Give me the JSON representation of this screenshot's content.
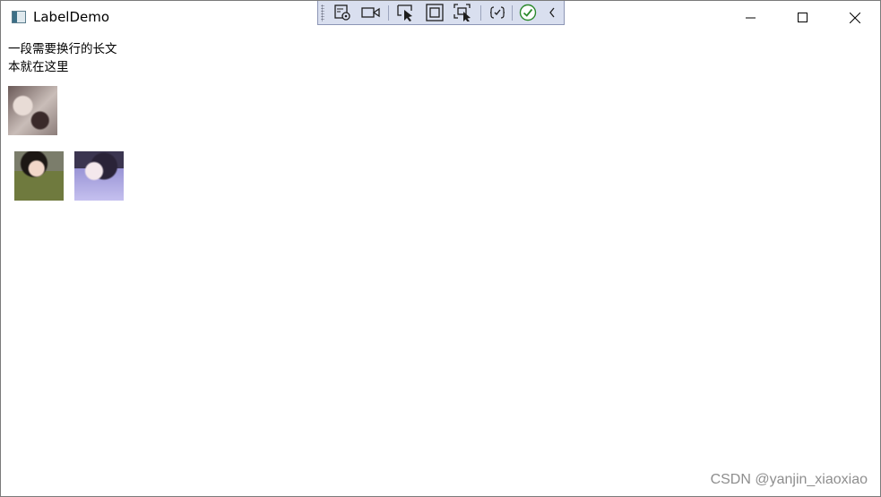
{
  "window": {
    "title": "LabelDemo",
    "controls": {
      "minimize": "minimize-icon",
      "maximize": "maximize-icon",
      "close": "close-icon"
    }
  },
  "devbar": {
    "tools": [
      "live-visual-tree-icon",
      "video-camera-icon",
      "select-element-icon",
      "display-layout-adorners-icon",
      "track-focus-icon",
      "hot-reload-icon",
      "check-circle-icon",
      "collapse-chevron-icon"
    ],
    "accent": "#d9dfef"
  },
  "content": {
    "wrap_text": "一段需要换行的长文本就在这里",
    "images": [
      "photo",
      "photo",
      "photo"
    ]
  },
  "watermark": "CSDN @yanjin_xiaoxiao"
}
